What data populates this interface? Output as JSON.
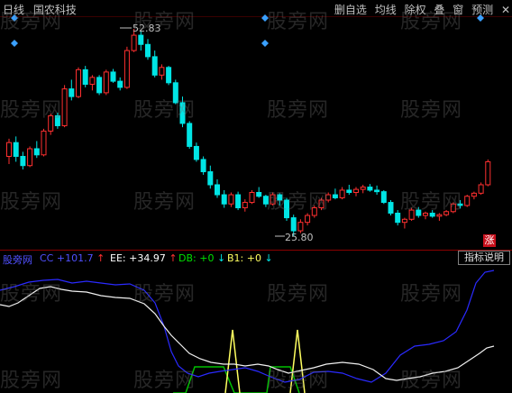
{
  "toolbar": {
    "left": [
      "日线",
      "国农科技"
    ],
    "right": [
      "删自选",
      "均线",
      "除权",
      "叠",
      "窗",
      "预测"
    ],
    "close": "✕"
  },
  "watermark": "股旁网",
  "price_chart": {
    "high_label": "52.83",
    "low_label": "25.80",
    "up_color": "#ff3030",
    "down_color": "#00e5e5",
    "candles": [
      [
        36.2,
        38.5,
        35.2,
        38.0
      ],
      [
        38.0,
        38.8,
        35.5,
        36.2
      ],
      [
        36.2,
        36.8,
        34.5,
        35.0
      ],
      [
        35.0,
        37.5,
        34.8,
        37.2
      ],
      [
        37.2,
        38.2,
        36.0,
        36.4
      ],
      [
        36.4,
        39.8,
        36.2,
        39.5
      ],
      [
        39.5,
        41.8,
        39.0,
        41.5
      ],
      [
        41.5,
        41.9,
        39.8,
        40.2
      ],
      [
        40.2,
        45.5,
        40.0,
        45.0
      ],
      [
        45.0,
        46.2,
        43.5,
        44.0
      ],
      [
        44.0,
        47.8,
        43.8,
        47.5
      ],
      [
        47.5,
        48.0,
        45.2,
        45.6
      ],
      [
        45.6,
        46.8,
        44.8,
        46.5
      ],
      [
        46.5,
        46.8,
        44.2,
        44.5
      ],
      [
        44.5,
        47.5,
        44.2,
        47.2
      ],
      [
        47.2,
        47.6,
        45.8,
        46.0
      ],
      [
        46.0,
        46.5,
        44.8,
        45.2
      ],
      [
        45.2,
        50.5,
        45.0,
        50.0
      ],
      [
        50.0,
        52.83,
        49.8,
        52.0
      ],
      [
        52.0,
        52.5,
        50.0,
        50.8
      ],
      [
        50.8,
        51.5,
        48.8,
        49.2
      ],
      [
        49.2,
        50.0,
        46.5,
        46.8
      ],
      [
        46.8,
        48.2,
        46.2,
        47.8
      ],
      [
        47.8,
        48.0,
        45.5,
        45.8
      ],
      [
        45.8,
        46.2,
        43.0,
        43.2
      ],
      [
        43.2,
        44.0,
        40.0,
        40.5
      ],
      [
        40.5,
        40.8,
        37.2,
        37.5
      ],
      [
        37.5,
        38.0,
        35.5,
        35.8
      ],
      [
        35.8,
        36.2,
        33.8,
        34.2
      ],
      [
        34.2,
        35.0,
        32.0,
        32.5
      ],
      [
        32.5,
        33.2,
        30.8,
        31.2
      ],
      [
        31.2,
        31.8,
        29.5,
        30.0
      ],
      [
        30.0,
        31.5,
        29.6,
        31.2
      ],
      [
        31.2,
        31.6,
        29.2,
        29.5
      ],
      [
        29.5,
        30.6,
        29.0,
        30.2
      ],
      [
        30.2,
        31.8,
        30.0,
        31.5
      ],
      [
        31.5,
        32.2,
        30.8,
        31.0
      ],
      [
        31.0,
        31.2,
        29.6,
        30.0
      ],
      [
        30.0,
        31.5,
        29.8,
        31.2
      ],
      [
        31.2,
        31.4,
        29.8,
        30.5
      ],
      [
        30.5,
        30.8,
        27.8,
        28.2
      ],
      [
        28.2,
        28.6,
        25.8,
        26.5
      ],
      [
        26.5,
        28.0,
        26.2,
        27.6
      ],
      [
        27.6,
        28.8,
        27.2,
        28.5
      ],
      [
        28.5,
        29.8,
        28.2,
        29.5
      ],
      [
        29.5,
        30.8,
        29.2,
        30.5
      ],
      [
        30.5,
        31.5,
        30.2,
        31.2
      ],
      [
        31.2,
        32.0,
        30.6,
        30.8
      ],
      [
        30.8,
        32.2,
        30.6,
        31.8
      ],
      [
        31.8,
        32.5,
        31.2,
        31.5
      ],
      [
        31.5,
        32.2,
        31.0,
        31.9
      ],
      [
        31.9,
        32.5,
        31.4,
        32.2
      ],
      [
        32.2,
        32.6,
        31.6,
        31.8
      ],
      [
        31.8,
        32.4,
        31.2,
        31.6
      ],
      [
        31.6,
        31.8,
        30.0,
        30.2
      ],
      [
        30.2,
        30.5,
        28.5,
        28.8
      ],
      [
        28.8,
        29.2,
        27.2,
        27.6
      ],
      [
        27.6,
        28.2,
        26.8,
        28.0
      ],
      [
        28.0,
        29.5,
        27.8,
        29.2
      ],
      [
        29.2,
        29.6,
        28.2,
        28.5
      ],
      [
        28.5,
        29.0,
        28.0,
        28.8
      ],
      [
        28.8,
        29.2,
        28.2,
        28.4
      ],
      [
        28.4,
        28.8,
        27.8,
        28.6
      ],
      [
        28.6,
        29.2,
        28.4,
        29.0
      ],
      [
        29.0,
        30.2,
        28.8,
        30.0
      ],
      [
        30.0,
        30.5,
        29.4,
        29.8
      ],
      [
        29.8,
        31.2,
        29.6,
        31.0
      ],
      [
        31.0,
        31.6,
        30.6,
        31.4
      ],
      [
        31.4,
        32.8,
        31.2,
        32.5
      ],
      [
        32.5,
        35.8,
        32.3,
        35.5
      ]
    ]
  },
  "indicator": {
    "name": "股旁网",
    "items": [
      {
        "label": "CC",
        "value": "+101.7",
        "arrow": "↑",
        "color": "#5050ff",
        "arrow_color": "#ff3030"
      },
      {
        "label": "EE:",
        "value": "+34.97",
        "arrow": "↑",
        "color": "#ffffff",
        "arrow_color": "#ff3030"
      },
      {
        "label": "DB:",
        "value": "+0",
        "arrow": "↓",
        "color": "#00e000",
        "arrow_color": "#00e5e5"
      },
      {
        "label": "B1:",
        "value": "+0",
        "arrow": "↓",
        "color": "#ffff60",
        "arrow_color": "#00e5e5"
      }
    ],
    "help_label": "指标说明",
    "zhang_badge": "涨"
  }
}
